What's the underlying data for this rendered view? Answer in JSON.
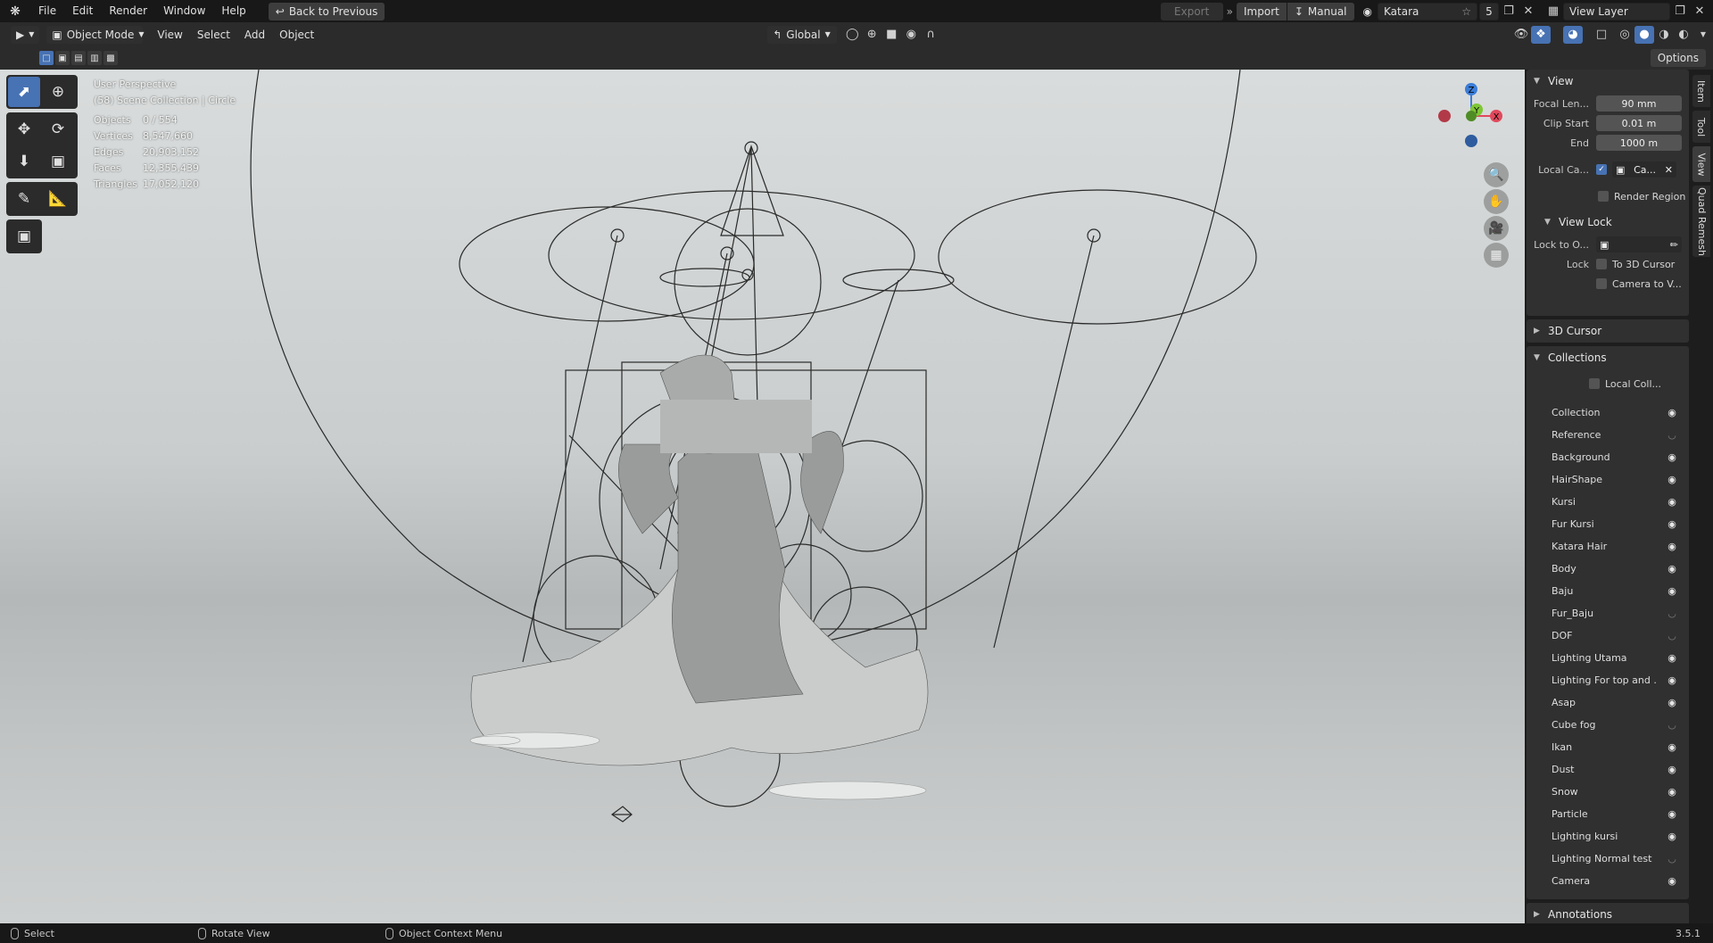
{
  "topbar": {
    "menu": [
      "File",
      "Edit",
      "Render",
      "Window",
      "Help"
    ],
    "back_label": "Back to Previous",
    "export_label": "Export",
    "import_label": "Import",
    "manual_label": "Manual",
    "scene_name": "Katara",
    "scene_count": "5",
    "view_layer": "View Layer"
  },
  "header": {
    "mode": "Object Mode",
    "menus": [
      "View",
      "Select",
      "Add",
      "Object"
    ],
    "orientation": "Global"
  },
  "viewport": {
    "perspective": "User Perspective",
    "collection_info": "(58) Scene Collection | Circle",
    "stats": [
      {
        "label": "Objects",
        "value": "0 / 554"
      },
      {
        "label": "Vertices",
        "value": "8,547,660"
      },
      {
        "label": "Edges",
        "value": "20,903,152"
      },
      {
        "label": "Faces",
        "value": "12,355,439"
      },
      {
        "label": "Triangles",
        "value": "17,052,120"
      }
    ],
    "gizmo": {
      "z": "Z",
      "y": "Y",
      "x": "X"
    }
  },
  "npanel": {
    "options_label": "Options",
    "view_panel": {
      "title": "View",
      "focal_label": "Focal Len...",
      "focal_value": "90 mm",
      "clip_start_label": "Clip Start",
      "clip_start_value": "0.01 m",
      "clip_end_label": "End",
      "clip_end_value": "1000 m",
      "local_camera_label": "Local Ca...",
      "local_camera_value": "Ca...",
      "render_region_label": "Render Region"
    },
    "view_lock": {
      "title": "View Lock",
      "lock_to_label": "Lock to O...",
      "lock_label": "Lock",
      "to_cursor_label": "To 3D Cursor",
      "camera_to_view_label": "Camera to V..."
    },
    "cursor_panel": {
      "title": "3D Cursor"
    },
    "collections_panel": {
      "title": "Collections",
      "local_label": "Local Coll...",
      "items": [
        {
          "name": "Collection",
          "visible": "on"
        },
        {
          "name": "Reference",
          "visible": "off"
        },
        {
          "name": "Background",
          "visible": "on"
        },
        {
          "name": "HairShape",
          "visible": "on"
        },
        {
          "name": "Kursi",
          "visible": "on"
        },
        {
          "name": "Fur Kursi",
          "visible": "on"
        },
        {
          "name": "Katara Hair",
          "visible": "on"
        },
        {
          "name": "Body",
          "visible": "on"
        },
        {
          "name": "Baju",
          "visible": "on"
        },
        {
          "name": "Fur_Baju",
          "visible": "off"
        },
        {
          "name": "DOF",
          "visible": "off"
        },
        {
          "name": "Lighting Utama",
          "visible": "on"
        },
        {
          "name": "Lighting For top and ...",
          "visible": "on"
        },
        {
          "name": "Asap",
          "visible": "on"
        },
        {
          "name": "Cube fog",
          "visible": "off"
        },
        {
          "name": "Ikan",
          "visible": "on"
        },
        {
          "name": "Dust",
          "visible": "on"
        },
        {
          "name": "Snow",
          "visible": "on"
        },
        {
          "name": "Particle",
          "visible": "on"
        },
        {
          "name": "Lighting kursi",
          "visible": "on"
        },
        {
          "name": "Lighting Normal test",
          "visible": "off"
        },
        {
          "name": "Camera",
          "visible": "on"
        }
      ]
    },
    "annotations_panel": {
      "title": "Annotations"
    }
  },
  "tabs": [
    "Item",
    "Tool",
    "View",
    "Quad Remesh"
  ],
  "statusbar": {
    "select": "Select",
    "rotate": "Rotate View",
    "context": "Object Context Menu",
    "version": "3.5.1"
  },
  "colors": {
    "accent": "#4772b3",
    "bg": "#1d1d1d",
    "panel": "#303030"
  }
}
